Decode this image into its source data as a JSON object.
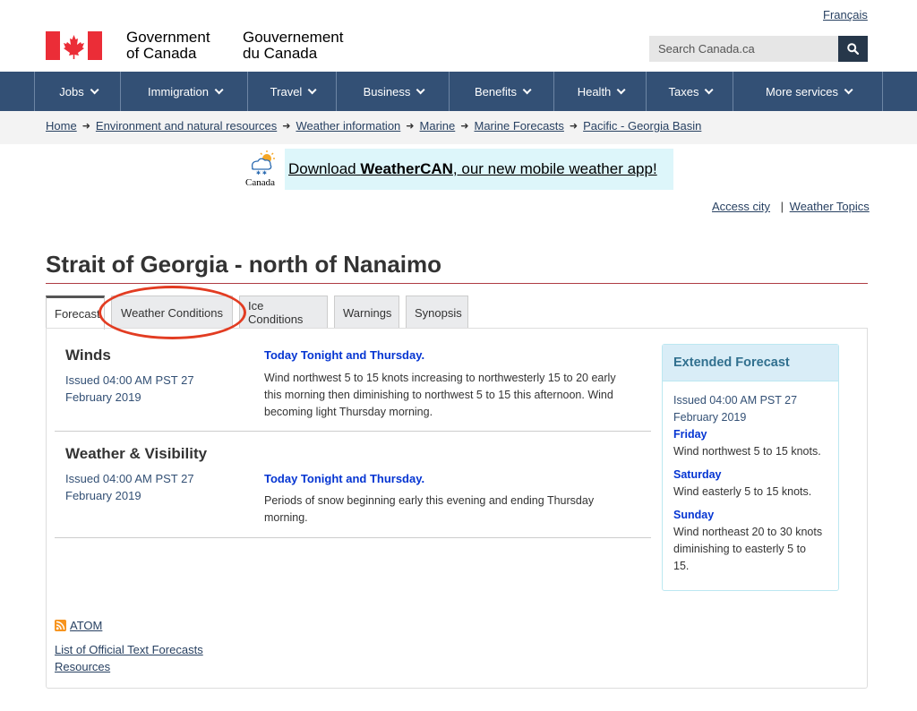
{
  "header": {
    "lang_toggle": "Français",
    "wordmark_en_line1": "Government",
    "wordmark_en_line2": "of Canada",
    "wordmark_fr_line1": "Gouvernement",
    "wordmark_fr_line2": "du Canada",
    "search_placeholder": "Search Canada.ca",
    "colors": {
      "flag_red": "#eb2d37",
      "nav_bg": "#335075",
      "search_btn": "#26374a"
    }
  },
  "nav": {
    "items": [
      {
        "label": "Jobs"
      },
      {
        "label": "Immigration"
      },
      {
        "label": "Travel"
      },
      {
        "label": "Business"
      },
      {
        "label": "Benefits"
      },
      {
        "label": "Health"
      },
      {
        "label": "Taxes"
      },
      {
        "label": "More services"
      }
    ]
  },
  "breadcrumb": {
    "items": [
      {
        "label": "Home"
      },
      {
        "label": "Environment and natural resources"
      },
      {
        "label": "Weather information"
      },
      {
        "label": "Marine"
      },
      {
        "label": "Marine Forecasts"
      },
      {
        "label": "Pacific - Georgia Basin"
      }
    ]
  },
  "banner": {
    "logo_text": "Canada",
    "text_prefix": "Download ",
    "text_bold": "WeatherCAN",
    "text_suffix": ", our new mobile weather app!"
  },
  "toplinks": {
    "access_city": "Access city",
    "separator": "|",
    "weather_topics": "Weather Topics"
  },
  "page": {
    "title": "Strait of Georgia - north of Nanaimo"
  },
  "tabs": [
    {
      "label": "Forecast",
      "active": true
    },
    {
      "label": "Weather Conditions",
      "active": false
    },
    {
      "label": "Ice Conditions",
      "active": false
    },
    {
      "label": "Warnings",
      "active": false
    },
    {
      "label": "Synopsis",
      "active": false
    }
  ],
  "winds": {
    "heading": "Winds",
    "issued_line1": "Issued 04:00 AM PST 27",
    "issued_line2": "February 2019",
    "period": "Today Tonight and Thursday.",
    "text_line1": "Wind northwest 5 to 15 knots increasing to northwesterly 15 to 20 early",
    "text_line2": "this morning then diminishing to northwest 5 to 15 this afternoon. Wind",
    "text_line3": "becoming light Thursday morning."
  },
  "weather_visibility": {
    "heading": "Weather & Visibility",
    "issued_line1": "Issued 04:00 AM PST 27",
    "issued_line2": "February 2019",
    "period": "Today Tonight and Thursday.",
    "text_line1": "Periods of snow beginning early this evening and ending Thursday",
    "text_line2": "morning."
  },
  "extended": {
    "heading": "Extended Forecast",
    "issued_line1": "Issued 04:00 AM PST 27",
    "issued_line2": "February 2019",
    "days": [
      {
        "day": "Friday",
        "lines": [
          "Wind northwest 5 to 15 knots."
        ]
      },
      {
        "day": "Saturday",
        "lines": [
          "Wind easterly 5 to 15 knots."
        ]
      },
      {
        "day": "Sunday",
        "lines": [
          "Wind northeast 20 to 30 knots",
          "diminishing to easterly 5 to",
          "15."
        ]
      }
    ]
  },
  "footer_links": {
    "atom": "ATOM",
    "official_text": "List of Official Text Forecasts",
    "resources": "Resources"
  }
}
